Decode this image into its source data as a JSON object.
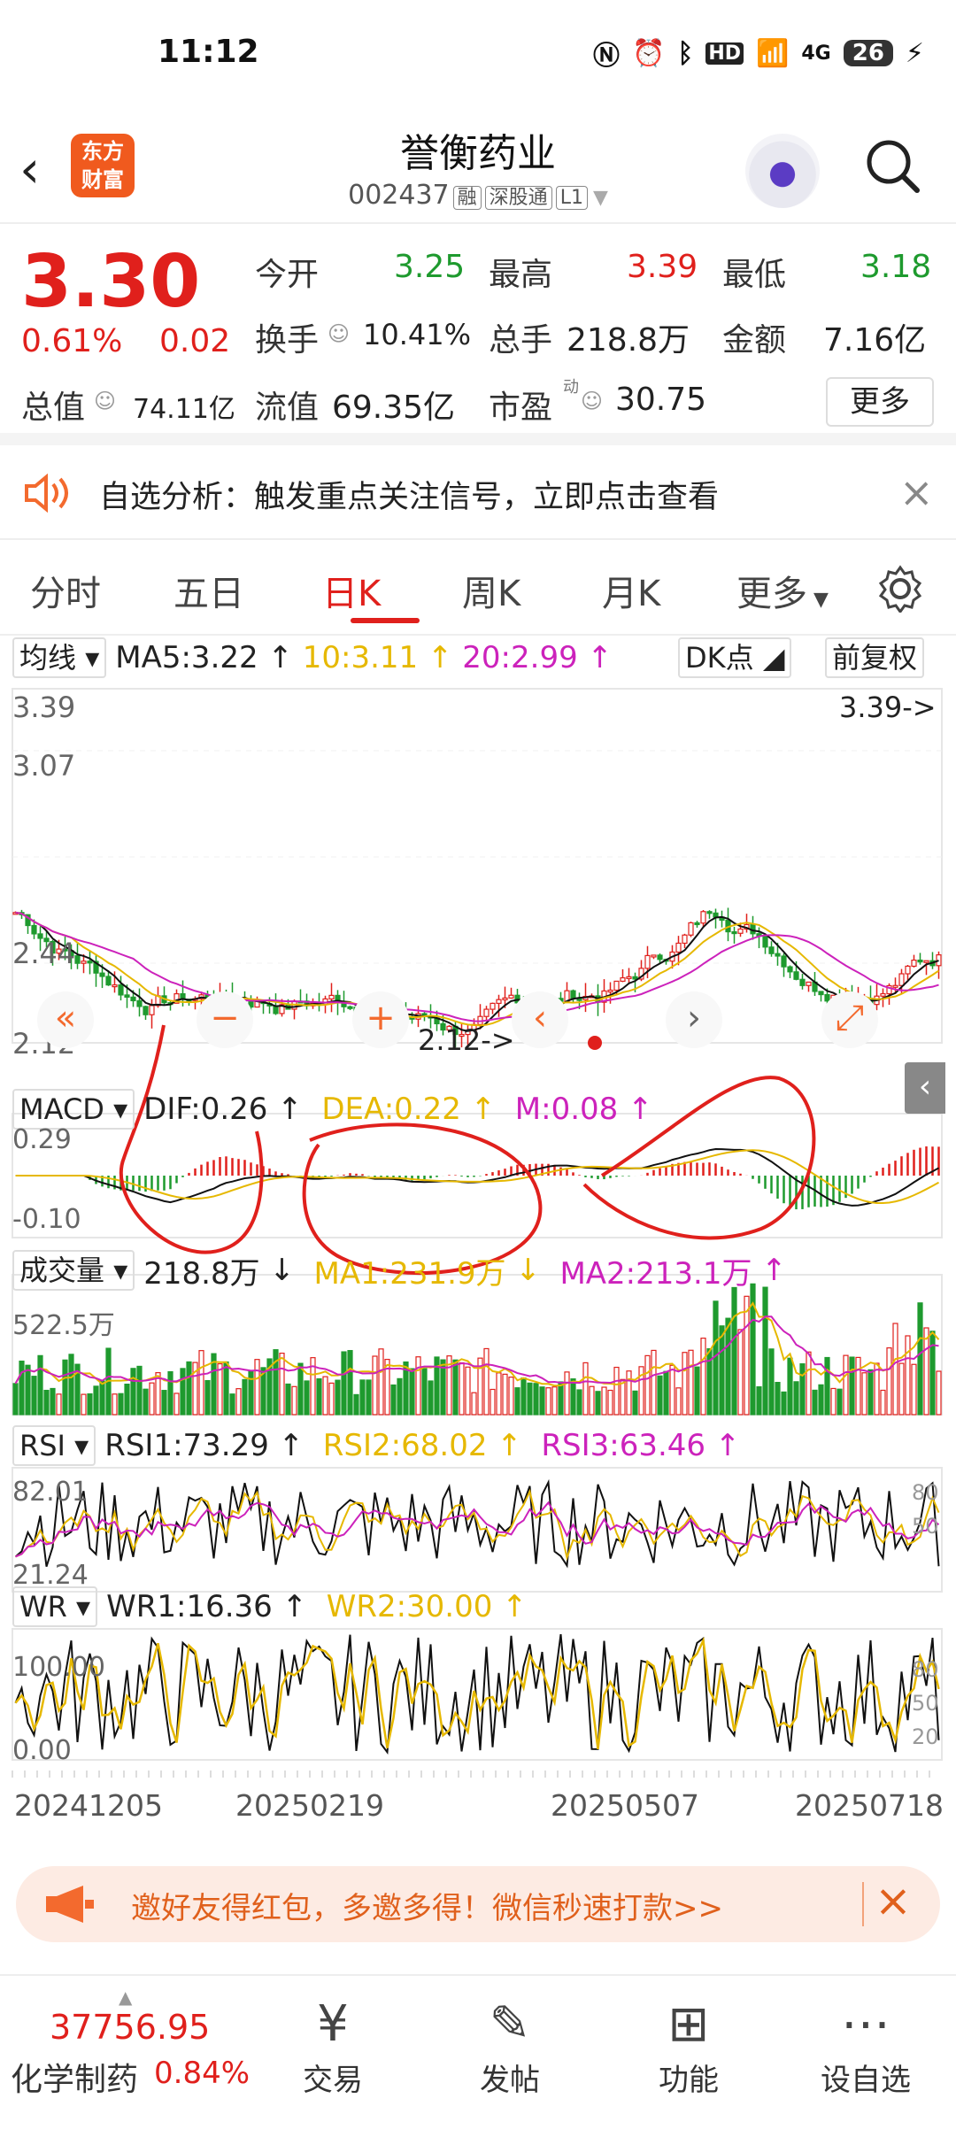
{
  "status": {
    "time": "11:12",
    "battery": "26",
    "network": "4G"
  },
  "header": {
    "logo_line1": "东方",
    "logo_line2": "财富",
    "name": "誉衡药业",
    "code": "002437",
    "tag1": "融",
    "tag2": "深股通",
    "tag3": "L1"
  },
  "quote": {
    "price": "3.30",
    "pct": "0.61%",
    "change": "0.02",
    "open_label": "今开",
    "open": "3.25",
    "high_label": "最高",
    "high": "3.39",
    "low_label": "最低",
    "low": "3.18",
    "turnover_label": "换手",
    "turnover": "10.41%",
    "volume_label": "总手",
    "volume": "218.8万",
    "amount_label": "金额",
    "amount": "7.16亿",
    "mcap_label": "总值",
    "mcap": "74.11亿",
    "float_label": "流值",
    "float": "69.35亿",
    "pe_label": "市盈",
    "pe_sup": "动",
    "pe": "30.75",
    "more": "更多"
  },
  "notice": {
    "text": "自选分析：触发重点关注信号，立即点击查看"
  },
  "tabs": [
    "分时",
    "五日",
    "日K",
    "周K",
    "月K",
    "更多"
  ],
  "ma_row": {
    "select": "均线",
    "ma5": "MA5:3.22",
    "ma10": "10:3.11",
    "ma20": "20:2.99",
    "dk": "DK点",
    "adj": "前复权"
  },
  "kline": {
    "y_top": "3.39",
    "y_2": "3.07",
    "y_3": "2.44",
    "y_bottom": "2.12",
    "high_marker": "3.39->",
    "low_marker": "2.12->"
  },
  "macd_row": {
    "select": "MACD",
    "dif": "DIF:0.26",
    "dea": "DEA:0.22",
    "m": "M:0.08",
    "y_top": "0.29",
    "y_bottom": "-0.10"
  },
  "vol_row": {
    "select": "成交量",
    "vol": "218.8万",
    "ma1": "MA1:231.9万",
    "ma2": "MA2:213.1万",
    "y_top": "522.5万"
  },
  "rsi_row": {
    "select": "RSI",
    "rsi1": "RSI1:73.29",
    "rsi2": "RSI2:68.02",
    "rsi3": "RSI3:63.46",
    "y_top": "82.01",
    "y_bottom": "21.24",
    "r_top": "80",
    "r_mid": "50"
  },
  "wr_row": {
    "select": "WR",
    "wr1": "WR1:16.36",
    "wr2": "WR2:30.00",
    "y_top": "100.00",
    "y_bottom": "0.00",
    "r_top": "80",
    "r_mid": "50",
    "r_bottom": "20"
  },
  "dates": [
    "20241205",
    "20250219",
    "20250507",
    "20250718"
  ],
  "promo": {
    "text": "邀好友得红包，多邀多得！微信秒速打款>>"
  },
  "bottom": {
    "index_value": "37756.95",
    "index_name": "化学制药",
    "index_pct": "0.84%",
    "trade": "交易",
    "post": "发帖",
    "func": "功能",
    "watch": "设自选"
  },
  "colors": {
    "up": "#e0201c",
    "down": "#1e9a2e",
    "ma10": "#e6b800",
    "ma20": "#cc22bb",
    "accent": "#f36a2e"
  }
}
